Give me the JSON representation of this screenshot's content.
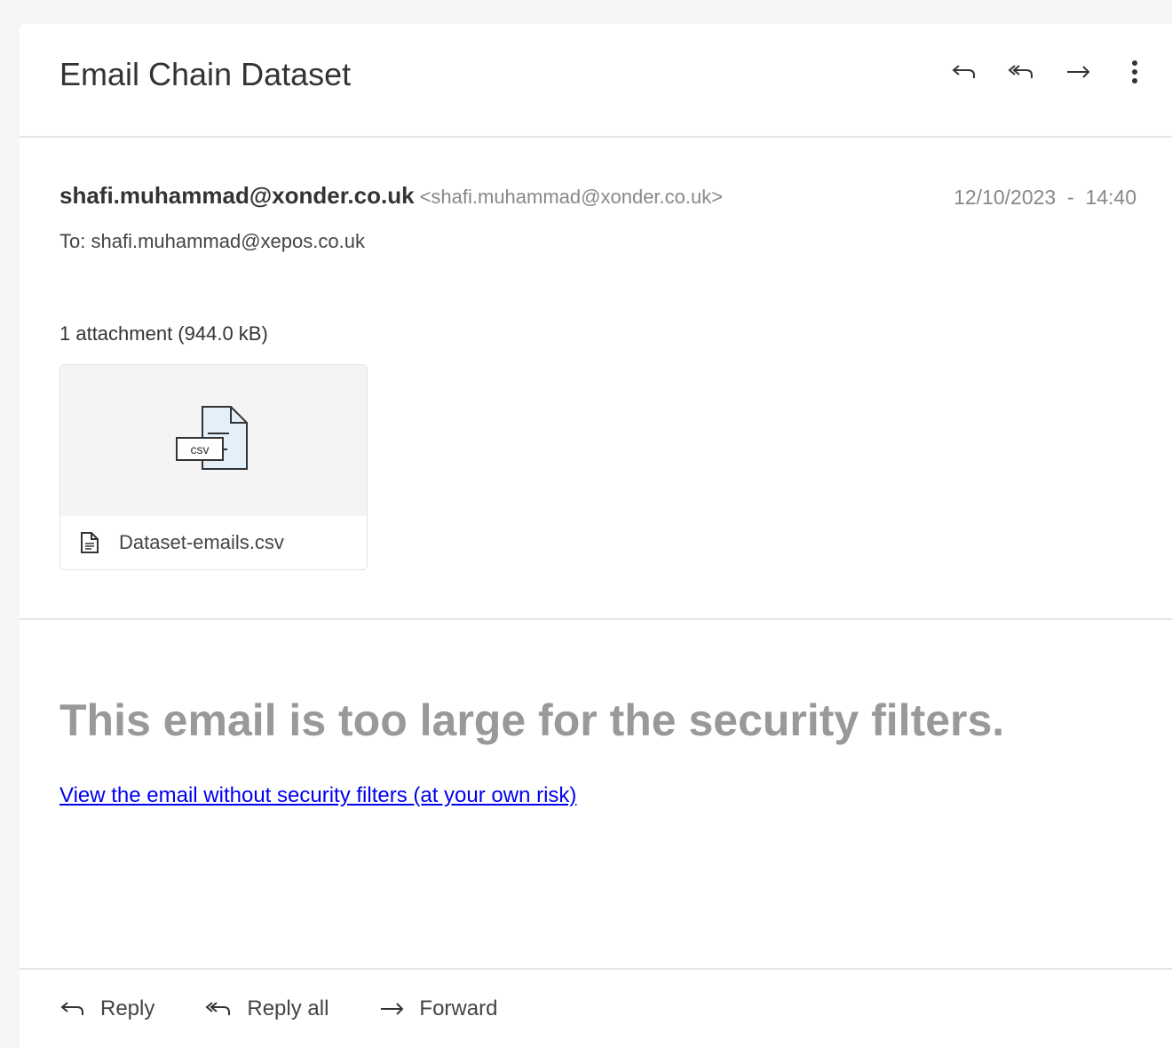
{
  "header": {
    "title": "Email Chain Dataset",
    "actions": [
      "reply-icon",
      "reply-all-icon",
      "forward-icon",
      "more-vertical-icon"
    ]
  },
  "message": {
    "sender_name": "shafi.muhammad@xonder.co.uk",
    "sender_address": "<shafi.muhammad@xonder.co.uk>",
    "date": "12/10/2023",
    "date_separator": "-",
    "time": "14:40",
    "to_label": "To:",
    "to_address": "shafi.muhammad@xepos.co.uk"
  },
  "attachments": {
    "summary": "1 attachment (944.0 kB)",
    "items": [
      {
        "file_name": "Dataset-emails.csv",
        "type_badge": "CSV"
      }
    ]
  },
  "body": {
    "warning": "This email is too large for the security filters.",
    "link": "View the email without security filters (at your own risk)",
    "link_color": "#0000ee"
  },
  "footer": {
    "reply": "Reply",
    "reply_all": "Reply all",
    "forward": "Forward"
  }
}
